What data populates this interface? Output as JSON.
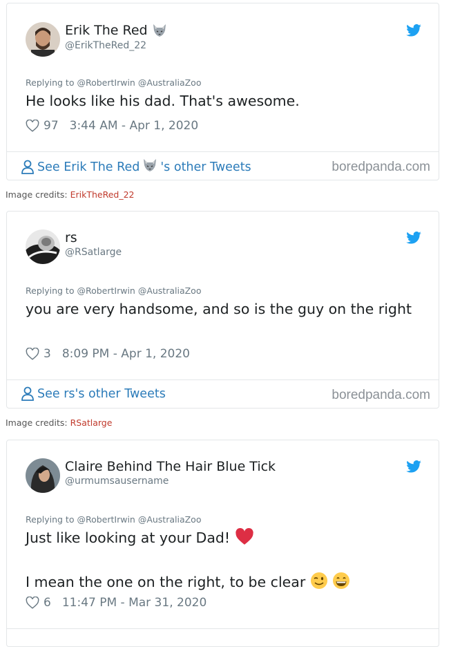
{
  "tweets": [
    {
      "name": "Erik The Red",
      "handle": "@ErikTheRed_22",
      "reply_prefix": "Replying to",
      "reply_to": "@RobertIrwin @AustraliaZoo",
      "text": "He looks like his dad. That's awesome.",
      "likes": "97",
      "time": "3:44 AM - Apr 1, 2020",
      "see_prefix": "See Erik The Red",
      "see_suffix": "'s other Tweets",
      "watermark": "boredpanda.com",
      "credit_label": "Image credits:",
      "credit_user": "ErikTheRed_22"
    },
    {
      "name": "rs",
      "handle": "@RSatlarge",
      "reply_prefix": "Replying to",
      "reply_to": "@RobertIrwin @AustraliaZoo",
      "text": "you are very handsome, and so is the guy on the right",
      "likes": "3",
      "time": "8:09 PM - Apr 1, 2020",
      "see_text": "See rs's other Tweets",
      "watermark": "boredpanda.com",
      "credit_label": "Image credits:",
      "credit_user": "RSatlarge"
    },
    {
      "name": "Claire Behind The Hair Blue Tick",
      "handle": "@urmumsausername",
      "reply_prefix": "Replying to",
      "reply_to": "@RobertIrwin @AustraliaZoo",
      "text_line1": "Just like looking at your Dad!",
      "text_line2": "I mean the one on the right, to be clear",
      "likes": "6",
      "time": "11:47 PM - Mar 31, 2020"
    }
  ],
  "colors": {
    "link": "#2b7bb9",
    "twitter_blue": "#1da1f2",
    "muted": "#697882",
    "credit_link": "#c0392b"
  },
  "icons": [
    "wolf-emoji-icon",
    "twitter-bird-icon",
    "heart-outline-icon",
    "person-icon",
    "red-heart-emoji-icon",
    "winking-face-emoji-icon",
    "grinning-face-emoji-icon"
  ]
}
